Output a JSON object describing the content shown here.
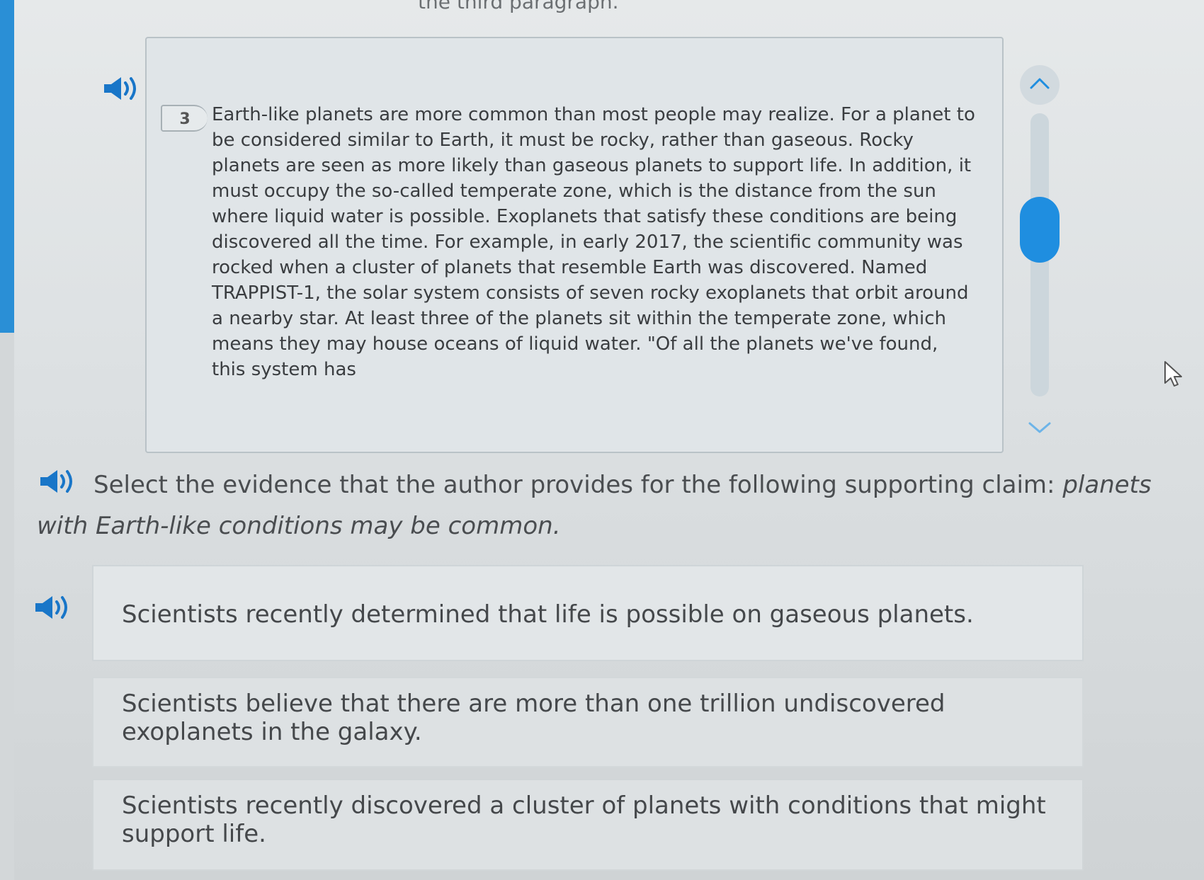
{
  "header": {
    "instruction_fragment": "the third paragraph."
  },
  "passage": {
    "paragraph_number": "3",
    "text": "Earth-like planets are more common than most people may realize. For a planet to be considered similar to Earth, it must be rocky, rather than gaseous. Rocky planets are seen as more likely than gaseous planets to support life. In addition, it must occupy the so-called temperate zone, which is the distance from the sun where liquid water is possible. Exoplanets that satisfy these conditions are being discovered all the time. For example, in early 2017, the scientific community was rocked when a cluster of planets that resemble Earth was discovered. Named TRAPPIST-1, the solar system consists of seven rocky exoplanets that orbit around a nearby star. At least three of the planets sit within the temperate zone, which means they may house oceans of liquid water. \"Of all the planets we've found, this system has"
  },
  "question": {
    "prompt": "Select the evidence that the author provides for the following supporting claim:",
    "claim": "planets with Earth-like conditions may be common."
  },
  "options": [
    "Scientists recently determined that life is possible on gaseous planets.",
    "Scientists believe that there are more than one trillion undiscovered exoplanets in the galaxy.",
    "Scientists recently discovered a cluster of planets with conditions that might support life."
  ],
  "icons": {
    "audio": "speaker-icon",
    "scroll_up": "chevron-up-icon",
    "scroll_down": "chevron-down-icon",
    "cursor": "mouse-pointer-icon"
  },
  "colors": {
    "accent": "#1f8ee0",
    "audio_icon": "#1976c8"
  }
}
